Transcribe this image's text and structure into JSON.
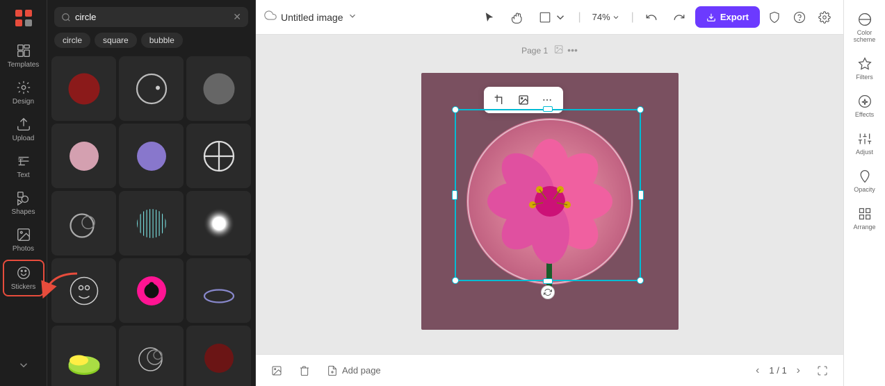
{
  "app": {
    "logo": "⊠",
    "title": "Untitled image"
  },
  "left_toolbar": {
    "items": [
      {
        "id": "templates",
        "label": "Templates",
        "icon": "templates"
      },
      {
        "id": "design",
        "label": "Design",
        "icon": "design"
      },
      {
        "id": "upload",
        "label": "Upload",
        "icon": "upload"
      },
      {
        "id": "text",
        "label": "Text",
        "icon": "text"
      },
      {
        "id": "shapes",
        "label": "Shapes",
        "icon": "shapes"
      },
      {
        "id": "photos",
        "label": "Photos",
        "icon": "photos"
      },
      {
        "id": "stickers",
        "label": "Stickers",
        "icon": "stickers"
      }
    ],
    "collapse_icon": "▾"
  },
  "search": {
    "query": "circle",
    "placeholder": "circle",
    "chips": [
      "circle",
      "square",
      "bubble"
    ]
  },
  "header": {
    "doc_title": "Untitled image",
    "zoom": "74%",
    "export_label": "Export",
    "tools": [
      "cursor",
      "hand",
      "frame",
      "undo",
      "redo"
    ]
  },
  "canvas": {
    "page_label": "Page 1",
    "zoom_level": "74%"
  },
  "context_menu": {
    "crop_icon": "⊡",
    "edit_icon": "✎",
    "more_icon": "•••"
  },
  "bottom_bar": {
    "add_page_label": "Add page",
    "page_current": "1",
    "page_total": "1"
  },
  "right_panel": {
    "items": [
      {
        "id": "color-scheme",
        "label": "Color scheme",
        "icon": "palette"
      },
      {
        "id": "filters",
        "label": "Filters",
        "icon": "filters"
      },
      {
        "id": "effects",
        "label": "Effects",
        "icon": "effects"
      },
      {
        "id": "adjust",
        "label": "Adjust",
        "icon": "adjust"
      },
      {
        "id": "opacity",
        "label": "Opacity",
        "icon": "opacity"
      },
      {
        "id": "arrange",
        "label": "Arrange",
        "icon": "arrange"
      }
    ]
  },
  "shapes": [
    {
      "type": "filled-circle-red",
      "row": 0,
      "col": 0
    },
    {
      "type": "outline-circle",
      "row": 0,
      "col": 1
    },
    {
      "type": "gray-circle",
      "row": 0,
      "col": 2
    },
    {
      "type": "pink-circle",
      "row": 1,
      "col": 0
    },
    {
      "type": "purple-circle",
      "row": 1,
      "col": 1
    },
    {
      "type": "crosshair-circle",
      "row": 1,
      "col": 2
    },
    {
      "type": "double-circle",
      "row": 2,
      "col": 0
    },
    {
      "type": "striped-circle",
      "row": 2,
      "col": 1
    },
    {
      "type": "glow-circle",
      "row": 2,
      "col": 2
    },
    {
      "type": "smiley-outline",
      "row": 3,
      "col": 0
    },
    {
      "type": "donut-pink",
      "row": 3,
      "col": 1
    },
    {
      "type": "ellipse-outline",
      "row": 3,
      "col": 2
    },
    {
      "type": "green-mound",
      "row": 4,
      "col": 0
    },
    {
      "type": "rings",
      "row": 4,
      "col": 1
    },
    {
      "type": "dark-red-circle",
      "row": 4,
      "col": 2
    }
  ]
}
